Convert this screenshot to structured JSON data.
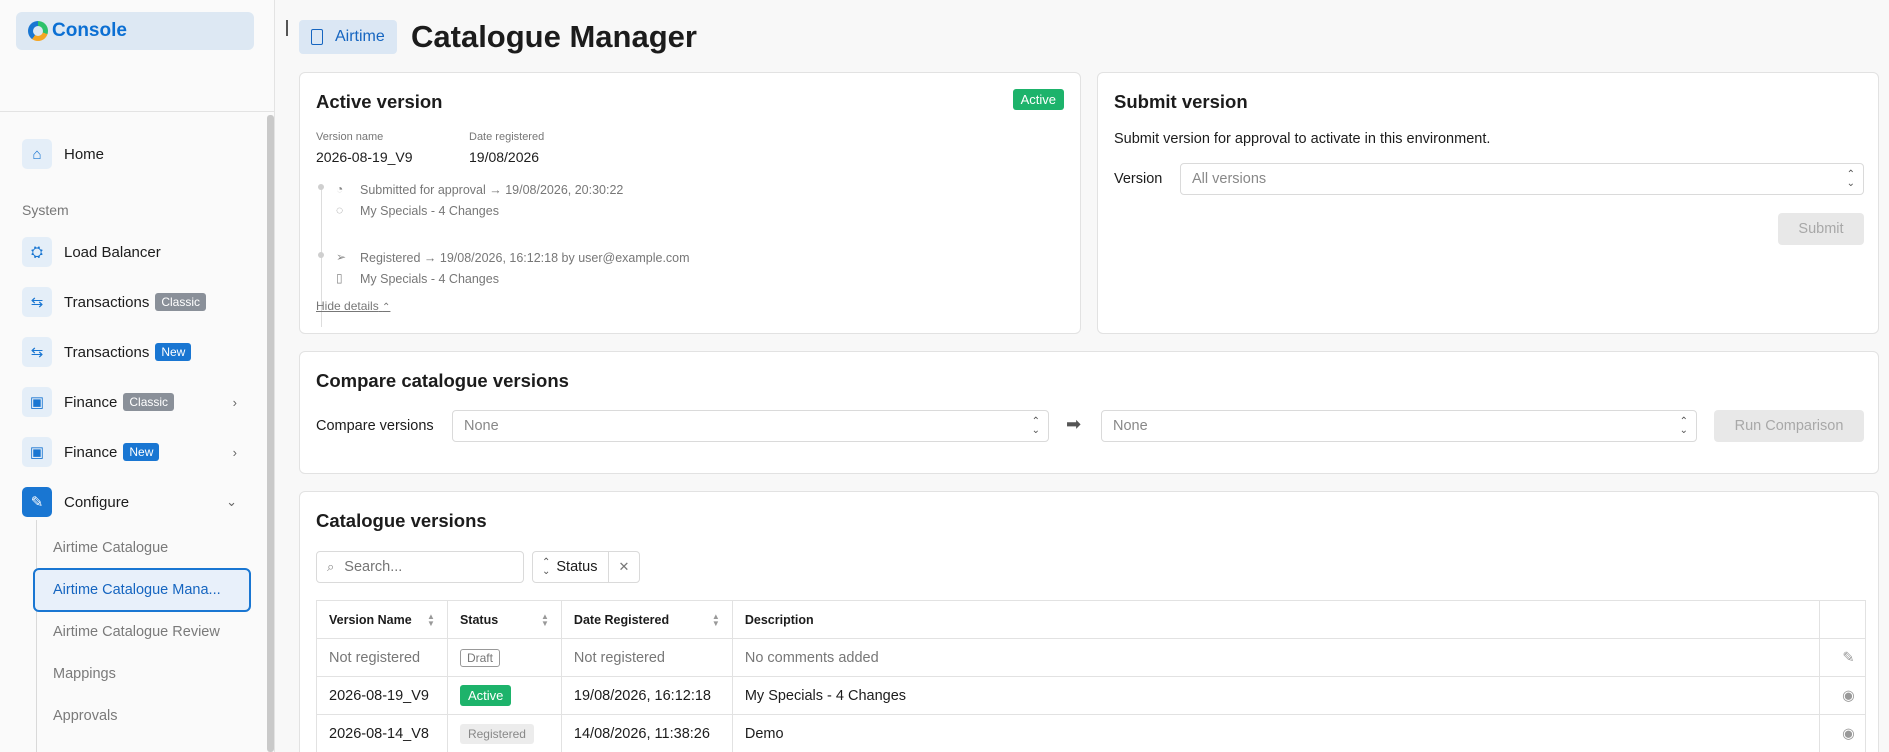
{
  "brand": {
    "name": "Console"
  },
  "sidebar": {
    "home": "Home",
    "section": "System",
    "items": [
      {
        "label": "Load Balancer",
        "icon": "network-icon"
      },
      {
        "label": "Transactions",
        "badge": "Classic",
        "icon": "transfer-icon"
      },
      {
        "label": "Transactions",
        "badge": "New",
        "icon": "transfer-icon"
      },
      {
        "label": "Finance",
        "badge": "Classic",
        "icon": "cash-icon"
      },
      {
        "label": "Finance",
        "badge": "New",
        "icon": "cash-icon"
      },
      {
        "label": "Configure",
        "icon": "wrench-icon"
      }
    ],
    "sub_items": [
      "Airtime Catalogue",
      "Airtime Catalogue Mana...",
      "Airtime Catalogue Review",
      "Mappings",
      "Approvals"
    ]
  },
  "header": {
    "pill": "Airtime",
    "title": "Catalogue Manager"
  },
  "active_version": {
    "title": "Active version",
    "status": "Active",
    "name_label": "Version name",
    "name_value": "2026-08-19_V9",
    "date_label": "Date registered",
    "date_value": "19/08/2026",
    "timeline": [
      {
        "event": "Submitted for approval → 19/08/2026, 20:30:22",
        "note": "My Specials - 4 Changes"
      },
      {
        "event": "Registered → 19/08/2026, 16:12:18 by user@example.com",
        "note": "My Specials - 4 Changes"
      }
    ],
    "hide_details": "Hide details"
  },
  "submit_version": {
    "title": "Submit version",
    "description": "Submit version for approval to activate in this environment.",
    "version_label": "Version",
    "version_placeholder": "All versions",
    "submit_label": "Submit"
  },
  "compare": {
    "title": "Compare catalogue versions",
    "label": "Compare versions",
    "from_value": "None",
    "to_value": "None",
    "run_label": "Run Comparison"
  },
  "catalogue_versions": {
    "title": "Catalogue versions",
    "search_placeholder": "Search...",
    "status_filter": "Status",
    "columns": [
      "Version Name",
      "Status",
      "Date Registered",
      "Description"
    ],
    "rows": [
      {
        "name": "Not registered",
        "status": "Draft",
        "date": "Not registered",
        "description": "No comments added"
      },
      {
        "name": "2026-08-19_V9",
        "status": "Active",
        "date": "19/08/2026, 16:12:18",
        "description": "My Specials - 4 Changes"
      },
      {
        "name": "2026-08-14_V8",
        "status": "Registered",
        "date": "14/08/2026, 11:38:26",
        "description": "Demo"
      }
    ]
  }
}
